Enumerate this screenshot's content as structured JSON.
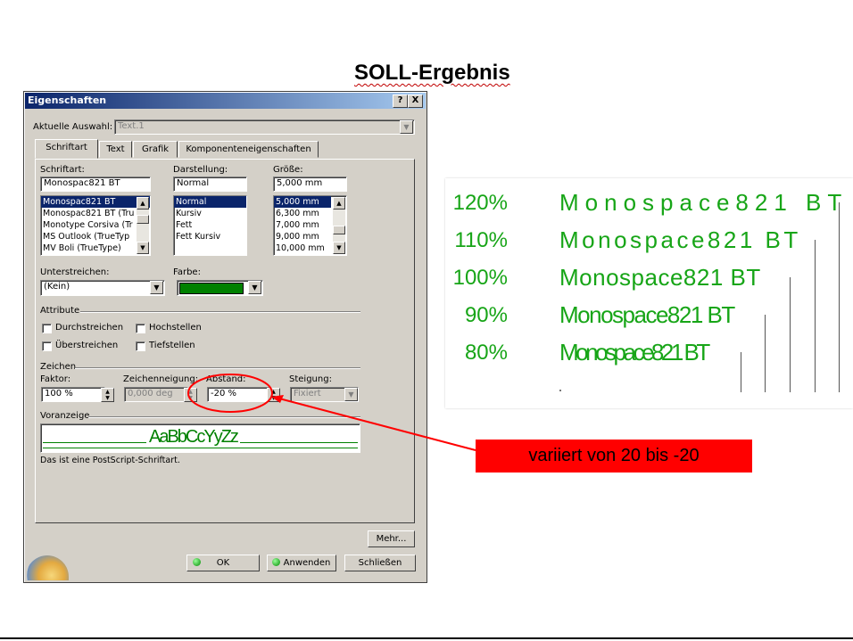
{
  "slide": {
    "title": "SOLL-Ergebnis"
  },
  "dialog": {
    "title": "Eigenschaften",
    "help_btn": "?",
    "close_btn": "X",
    "selection_label": "Aktuelle Auswahl:",
    "selection_value": "Text.1",
    "tabs": [
      {
        "label": "Schriftart"
      },
      {
        "label": "Text"
      },
      {
        "label": "Grafik"
      },
      {
        "label": "Komponenteneigenschaften"
      }
    ],
    "font": {
      "label": "Schriftart:",
      "value": "Monospac821 BT",
      "items": [
        "Monospac821 BT",
        "Monospac821 BT (Tru",
        "Monotype Corsiva (Tr",
        "MS Outlook (TrueTyp",
        "MV Boli (TrueType)"
      ]
    },
    "style": {
      "label": "Darstellung:",
      "value": "Normal",
      "items": [
        "Normal",
        "Kursiv",
        "Fett",
        "Fett Kursiv"
      ]
    },
    "size": {
      "label": "Größe:",
      "value": "5,000 mm",
      "items": [
        "5,000 mm",
        "6,300 mm",
        "7,000 mm",
        "9,000 mm",
        "10,000 mm"
      ]
    },
    "underline": {
      "label": "Unterstreichen:",
      "value": "(Kein)"
    },
    "color": {
      "label": "Farbe:",
      "swatch": "#008000"
    },
    "attributes": {
      "label": "Attribute",
      "strike": "Durchstreichen",
      "superscript": "Hochstellen",
      "overline": "Überstreichen",
      "subscript": "Tiefstellen"
    },
    "chars": {
      "label": "Zeichen",
      "factor_label": "Faktor:",
      "factor_value": "100 %",
      "slant_label": "Zeichenneigung:",
      "slant_value": "0,000 deg",
      "spacing_label": "Abstand:",
      "spacing_value": "-20 %",
      "pitch_label": "Steigung:",
      "pitch_value": "Fixiert"
    },
    "preview": {
      "label": "Voranzeige",
      "text": "AaBbCcYyZz"
    },
    "info": "Das ist eine PostScript-Schriftart.",
    "more_btn": "Mehr...",
    "ok_btn": "OK",
    "apply_btn": "Anwenden",
    "close_dialog_btn": "Schließen"
  },
  "samples": [
    {
      "percent": "120%",
      "text": "Monospace821 BT"
    },
    {
      "percent": "110%",
      "text": "Monospace821 BT"
    },
    {
      "percent": "100%",
      "text": "Monospace821 BT"
    },
    {
      "percent": "90%",
      "text": "Monospace821 BT"
    },
    {
      "percent": "80%",
      "text": "Monospace821 BT"
    }
  ],
  "annotation": {
    "text": "variiert von 20 bis -20",
    "color": "#ff0000"
  },
  "colors": {
    "green_text": "#17a517",
    "accent": "#0a246a"
  }
}
